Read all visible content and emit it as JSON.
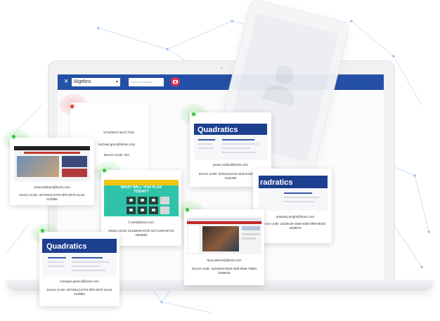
{
  "toolbar": {
    "close_icon": "×",
    "class_select": "Algebra",
    "select_caret": "▾",
    "search_placeholder": "Search by student",
    "camera_icon": "camera-icon"
  },
  "colors": {
    "toolbar_blue": "#2450a7",
    "online_green": "#3bc43b",
    "offline_red": "#e03b3b",
    "camera_pink": "#e2335a"
  },
  "cards": [
    {
      "status": "inactive",
      "status_text": "STUDENT INACTIVE",
      "email": "michael.grant@iboss.com",
      "uuid": "Device UUID: N/A"
    },
    {
      "status": "online",
      "screen_title": "Quadratics",
      "email": "jonas.marks@iboss.com",
      "uuid_lines": [
        "Device UUID: 0af11ae21f4d-443a-b1d2-a2c20",
        "103c485"
      ]
    },
    {
      "status": "online",
      "email": "omar.bakhan@iboss.com",
      "uuid_lines": [
        "Device UUID: 40715612-b704-4f04-9376-11c2a",
        "212bf8e"
      ]
    },
    {
      "status": "online",
      "banner_text_1": "WHAT WILL YOU PLAY",
      "banner_text_2": "TODAY?",
      "email": "li.wei@iboss.com",
      "uuid_lines": [
        "Device UUID: 614ad049-227b-40cf-a446-9e722",
        "e6065d0"
      ]
    },
    {
      "status": "online",
      "screen_title": "radratics",
      "email": "pradeep.singh@iboss.com",
      "uuid_lines": [
        "vice UUID: c6dc9c28-18a6-4b8b-8f58-39181",
        "1609b75"
      ]
    },
    {
      "status": "online",
      "email": "larry.adams@iboss.com",
      "uuid_lines": [
        "Device UUID: 3a1904ef-00d4-48df-9b66-79854",
        "0465646"
      ]
    },
    {
      "status": "online",
      "screen_title": "Quadratics",
      "email": "monique.green@iboss.com",
      "uuid_lines": [
        "Device UUID: 40715612-b704-4f04-9376-11c2a",
        "212bf8e"
      ]
    }
  ]
}
